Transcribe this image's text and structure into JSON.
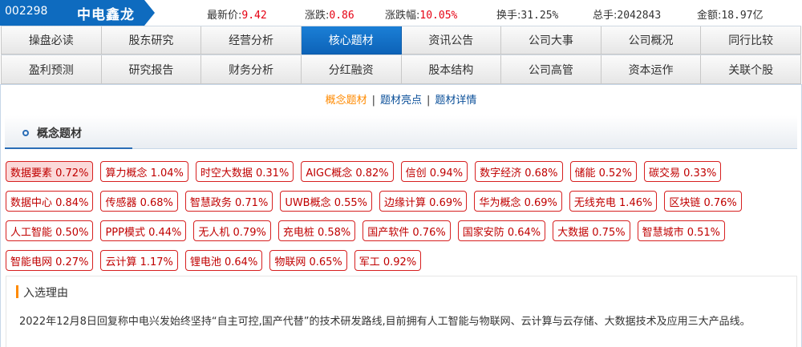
{
  "header": {
    "stock_code": "002298",
    "stock_name": "中电鑫龙",
    "quotes": [
      {
        "label": "最新价:",
        "value": "9.42",
        "red": true
      },
      {
        "label": "涨跌:",
        "value": "0.86",
        "red": true
      },
      {
        "label": "涨跌幅:",
        "value": "10.05%",
        "red": true
      },
      {
        "label": "换手:",
        "value": "31.25%",
        "red": false
      },
      {
        "label": "总手:",
        "value": "2042843",
        "red": false
      },
      {
        "label": "金额:",
        "value": "18.97亿",
        "red": false
      }
    ],
    "colors": {
      "brand": "#0e6bbf",
      "up": "#e60012"
    }
  },
  "nav": {
    "rows": [
      [
        "操盘必读",
        "股东研究",
        "经营分析",
        "核心题材",
        "资讯公告",
        "公司大事",
        "公司概况",
        "同行比较"
      ],
      [
        "盈利预测",
        "研究报告",
        "财务分析",
        "分红融资",
        "股本结构",
        "公司高管",
        "资本运作",
        "关联个股"
      ]
    ],
    "active": "核心题材"
  },
  "subtabs": {
    "items": [
      "概念题材",
      "题材亮点",
      "题材详情"
    ],
    "separator": "|",
    "active": "概念题材"
  },
  "section": {
    "title": "概念题材"
  },
  "tags": {
    "rows": [
      [
        "数据要素 0.72%",
        "算力概念 1.04%",
        "时空大数据 0.31%",
        "AIGC概念 0.82%",
        "信创 0.94%",
        "数字经济 0.68%",
        "储能 0.52%",
        "碳交易 0.33%"
      ],
      [
        "数据中心 0.84%",
        "传感器 0.68%",
        "智慧政务 0.71%",
        "UWB概念 0.55%",
        "边缘计算 0.69%",
        "华为概念 0.69%",
        "无线充电 1.46%",
        "区块链 0.76%"
      ],
      [
        "人工智能 0.50%",
        "PPP模式 0.44%",
        "无人机 0.79%",
        "充电桩 0.58%",
        "国产软件 0.76%",
        "国家安防 0.64%",
        "大数据 0.75%",
        "智慧城市 0.51%"
      ],
      [
        "智能电网 0.27%",
        "云计算 1.17%",
        "锂电池 0.64%",
        "物联网 0.65%",
        "军工 0.92%"
      ]
    ],
    "selected": "数据要素 0.72%"
  },
  "reason": {
    "label": "入选理由",
    "text": "2022年12月8日回复称中电兴发始终坚持“自主可控,国产代替”的技术研发路线,目前拥有人工智能与物联网、云计算与云存储、大数据技术及应用三大产品线。"
  }
}
